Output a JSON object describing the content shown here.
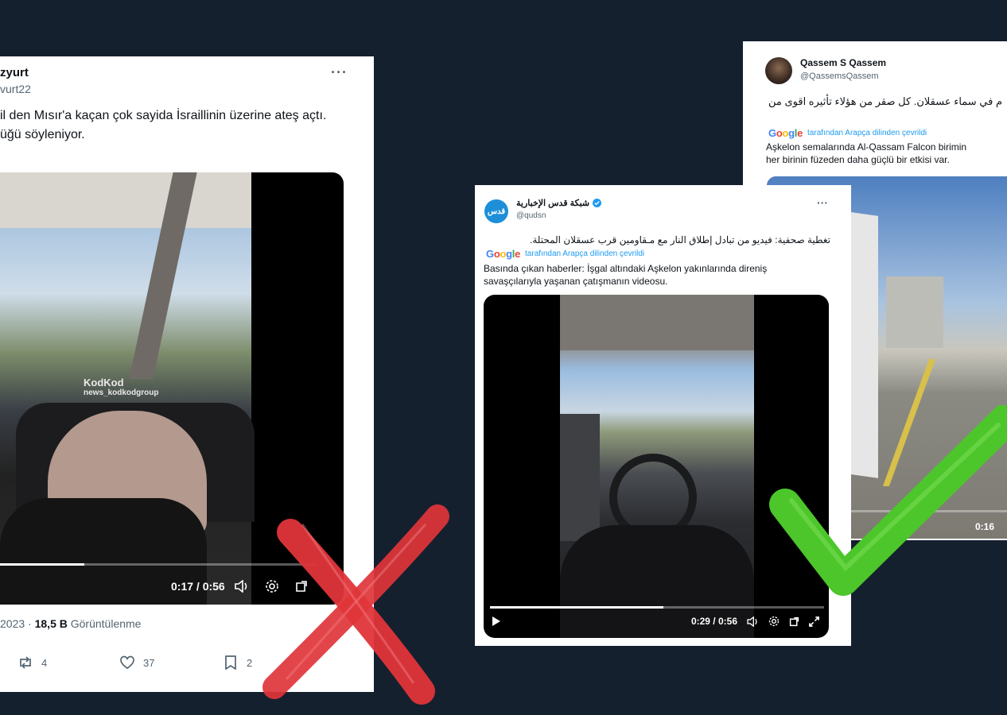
{
  "tweet1": {
    "name": "zyurt",
    "handle": "vurt22",
    "text_line1": "il den Mısır'a kaçan çok sayida İsraillinin üzerine ateş açtı.",
    "text_line2": "üğü söyleniyor.",
    "watermark_line1": "KodKod",
    "watermark_line2": "news_kodkodgroup",
    "time_display": "0:17 / 0:56",
    "progress": 0.3,
    "date": "2023",
    "views_count": "18,5 B",
    "views_label": "Görüntülenme",
    "retweets": "4",
    "likes": "37",
    "bookmarks": "2",
    "verdict": "incorrect"
  },
  "tweet2": {
    "name": "شبكة قدس الإخبارية",
    "handle": "@qudsn",
    "avatar_text": "قدس",
    "text_ar": "تغطية صحفية: فيديو من تبادل إطلاق النار مع مـقاومين قرب عسقلان المحتلة.",
    "translated_by": "tarafından Arapça dilinden çevrildi",
    "translation_line1": "Basında çıkan haberler: İşgal altındaki Aşkelon yakınlarında direniş",
    "translation_line2": "savaşçılarıyla yaşanan çatışmanın videosu.",
    "time_display": "0:29 / 0:56",
    "progress": 0.52
  },
  "tweet3": {
    "name": "Qassem S Qassem",
    "handle": "@QassemsQassem",
    "text_ar": "م في سماء عسقلان. كل صقر من هؤلاء تأثيره اقوى من",
    "translated_by": "tarafından Arapça dilinden çevrildi",
    "translation_line1": "Aşkelon semalarında Al-Qassam Falcon birimin",
    "translation_line2": "her birinin füzeden daha güçlü bir etkisi var.",
    "time_display": "0:16",
    "verdict": "correct"
  },
  "colors": {
    "background": "#15202f",
    "cross": "#e0353a",
    "check": "#4cc62a",
    "verified": "#1d9bf0"
  }
}
